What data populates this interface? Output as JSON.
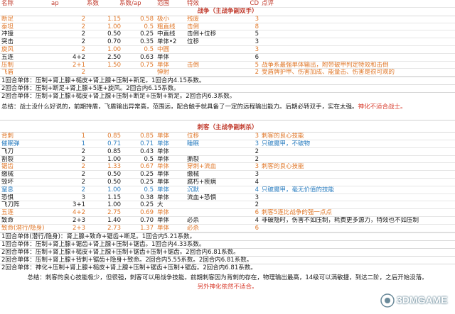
{
  "header": [
    "名称",
    "ap",
    "系数",
    "系数/ap",
    "范围",
    "特效",
    "CD",
    "点评"
  ],
  "warrior": {
    "title": "战争（主战争副双手）",
    "rows": [
      {
        "cells": [
          "断足",
          "2",
          "1.15",
          "0.58",
          "极小",
          "残废",
          "3",
          ""
        ],
        "color": "orange"
      },
      {
        "cells": [
          "泰坦",
          "2",
          "1.00",
          "0.5",
          "粗直线",
          "击倒",
          "8",
          ""
        ],
        "color": "orange"
      },
      {
        "cells": [
          "冲撞",
          "2",
          "0.50",
          "0.25",
          "中直线",
          "击倒+位移",
          "5",
          ""
        ],
        "color": "normal"
      },
      {
        "cells": [
          "突击",
          "2",
          "0.70",
          "0.35",
          "单体•2",
          "位移",
          "3",
          ""
        ],
        "color": "normal"
      },
      {
        "cells": [
          "旋风",
          "2",
          "1.00",
          "0.5",
          "中圆",
          "",
          "3",
          ""
        ],
        "color": "orange"
      },
      {
        "cells": [
          "五连",
          "4+2",
          "2.50",
          "0.63",
          "单体",
          "",
          "6",
          ""
        ],
        "color": "normal"
      },
      {
        "cells": [
          "压制",
          "2+1",
          "1.50",
          "0.75",
          "单体",
          "击倒",
          "5",
          "战争系最强单体输出，附带破甲判定特效和击倒"
        ],
        "color": "orange"
      },
      {
        "cells": [
          "飞盾",
          "2",
          "",
          "",
          "弹射",
          "",
          "2",
          "受盾牌护甲、伤害加成、能量击、伤害是很可观的"
        ],
        "color": "orange"
      }
    ],
    "combos": [
      "1回合单体：压制+肾上腺+槌皮+肾上腺+压制+新足。1回合内4.15系数。",
      "2回合单体：压制+断足+肾上腺+5连+旋风。2回合内6.15系数。",
      "2回合单体：压制+肾上腺+槌皮+肾上腺+压制+断足+压制+新足。2回合内6.3系数。"
    ],
    "summary": "总结：战士没什么好说的，前期持盾，飞盾输出异常高，范围远，配合触手就具备了一定的远程输出能力。后期必转双手，实在太强。",
    "summary_red": "神化不适合战士。"
  },
  "assassin": {
    "title": "刺客（主战争副刺杀）",
    "rows": [
      {
        "cells": [
          "背刺",
          "1",
          "0.85",
          "0.85",
          "单体",
          "位移",
          "3",
          "刺客的良心技能"
        ],
        "color": "orange"
      },
      {
        "cells": [
          "催眠弹",
          "1",
          "0.71",
          "0.71",
          "单体",
          "睡眠",
          "3",
          "只破魔甲，不破物"
        ],
        "color": "blue"
      },
      {
        "cells": [
          "飞刀",
          "2",
          "0.85",
          "0.43",
          "单体",
          "",
          "2",
          ""
        ],
        "color": "normal"
      },
      {
        "cells": [
          "割裂",
          "2",
          "1.00",
          "0.5",
          "单体",
          "撕裂",
          "2",
          ""
        ],
        "color": "normal"
      },
      {
        "cells": [
          "锯齿",
          "2",
          "1.33",
          "0.67",
          "单体",
          "穿刺+流血",
          "3",
          "刺客的良心技能"
        ],
        "color": "orange"
      },
      {
        "cells": [
          "缴械",
          "2",
          "0.50",
          "0.25",
          "单体",
          "缴械",
          "3",
          ""
        ],
        "color": "normal"
      },
      {
        "cells": [
          "毁坏",
          "2",
          "0.50",
          "0.25",
          "单体",
          "腐朽+疾病",
          "4",
          ""
        ],
        "color": "normal"
      },
      {
        "cells": [
          "窒息",
          "2",
          "1.00",
          "0.5",
          "单体",
          "沉默",
          "4",
          "只破魔甲，毫无价值的技能"
        ],
        "color": "blue"
      },
      {
        "cells": [
          "恐惧",
          "3",
          "1.15",
          "0.38",
          "单体",
          "流血+恐惧",
          "3",
          ""
        ],
        "color": "normal"
      },
      {
        "cells": [
          "飞刀阵",
          "3+1",
          "1.00",
          "0.25",
          "大",
          "",
          "2",
          ""
        ],
        "color": "normal"
      },
      {
        "cells": [
          "五连",
          "4+2",
          "2.75",
          "0.69",
          "单体",
          "",
          "6",
          "刺客5连比战争的强一点点"
        ],
        "color": "orange"
      },
      {
        "cells": [
          "致命",
          "2+3",
          "1.40",
          "0.70",
          "单体",
          "必杀",
          "4",
          "非破隐时，伤害不如压制，耗费更多源力，特效也不如压制"
        ],
        "color": "normal"
      },
      {
        "cells": [
          "致命(潜行/隐身)",
          "2+3",
          "2.73",
          "1.37",
          "单体",
          "必杀",
          "6",
          ""
        ],
        "color": "orange"
      }
    ],
    "combos": [
      "1回合单体(潜行/隐身)：肾上腺+致命+锯齿+断足。1回合内5.21系数。",
      "1回合单体：压制+肾上腺+锯齿+肾上腺+压制+锯齿。1回合内4.33系数。",
      "2回合单体：压制+肾上腺+槌皮+肾上腺+压制+锯齿+压制+锯齿。2回合内6.81系数。",
      "2回合单体：压制+肾上腺+背刺+锯齿+隐身+致命。2回合内5.55系数。2回合内6.81系数。",
      "2回合单体：神化+压制+肾上腺+槌皮+肾上腺+压制+锯齿+压制+锯齿。2回合内6.81系数。"
    ],
    "summary": "总结：刺客的良心技能极少，但很强，刺客可以用战争技能。前期刺客因为背刺的存在，物理输出最高，14级可以满敏捷，到达二阶，之后开始没落。",
    "summary_red": "另外神化依然不适合。"
  },
  "watermark": "3DMGAME",
  "colors": {
    "orange": "#e0782a",
    "blue": "#2d7fc1",
    "red": "#d83a2b"
  }
}
